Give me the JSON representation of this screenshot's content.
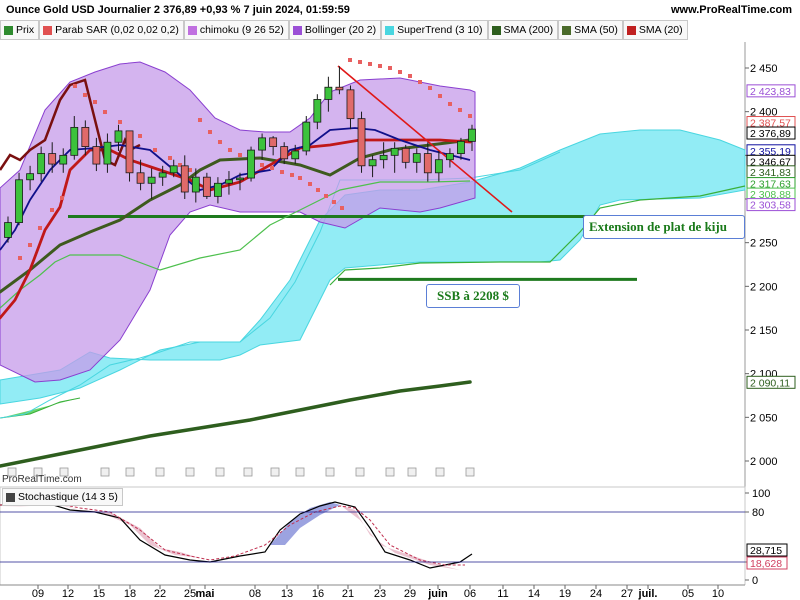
{
  "header": {
    "title": "Ounce Gold USD Journalier 2 376,89 +0,93 % 7 juin 2024, 01:59:59",
    "site": "www.ProRealTime.com"
  },
  "legend": [
    {
      "label": "Prix",
      "color": "#2e8b2e",
      "icon": "price-swatch"
    },
    {
      "label": "Parab SAR (0,02 0,02 0,2)",
      "color": "#e05050",
      "icon": "sar-swatch"
    },
    {
      "label": "chimoku (9 26 52)",
      "color": "#c070e0",
      "icon": "ichimoku-swatch"
    },
    {
      "label": "Bollinger (20 2)",
      "color": "#9b4fd6",
      "icon": "bollinger-swatch"
    },
    {
      "label": "SuperTrend (3 10)",
      "color": "#49d6e0",
      "icon": "supertrend-swatch"
    },
    {
      "label": "SMA (200)",
      "color": "#2e5e1e",
      "icon": "sma200-swatch"
    },
    {
      "label": "SMA (50)",
      "color": "#4a6a2a",
      "icon": "sma50-swatch"
    },
    {
      "label": "SMA (20)",
      "color": "#c02020",
      "icon": "sma20-swatch"
    }
  ],
  "annotations": {
    "extension": "Extension de plat de kiju",
    "ssb": "SSB à 2208 $"
  },
  "logo": "ProRealTime.com",
  "stochastic": {
    "label": "Stochastique (14 3 5)",
    "axis_ticks": [
      "100",
      "80",
      "20",
      "0"
    ],
    "badges": [
      {
        "value": "28,715",
        "color": "#000000"
      },
      {
        "value": "18,628",
        "color": "#d04060"
      }
    ]
  },
  "chart_data": {
    "type": "candlestick",
    "title": "Ounce Gold USD Journalier 2 376,89 +0,93 % 7 juin 2024, 01:59:59",
    "y_ticks": [
      "2 450",
      "2 400",
      "2 350",
      "2 300",
      "2 250",
      "2 200",
      "2 150",
      "2 100",
      "2 050",
      "2 000"
    ],
    "y_tick_values": [
      2450,
      2400,
      2350,
      2300,
      2250,
      2200,
      2150,
      2100,
      2050,
      2000
    ],
    "ylim": [
      1990,
      2475
    ],
    "x_ticks": [
      "09",
      "12",
      "15",
      "18",
      "22",
      "25",
      "mai",
      "08",
      "13",
      "16",
      "21",
      "23",
      "29",
      "juin",
      "06",
      "11",
      "14",
      "19",
      "24",
      "27",
      "juil.",
      "05",
      "10"
    ],
    "price_badges": [
      {
        "value": "2 423,83",
        "color": "#9b4fd6",
        "y": 2423.83
      },
      {
        "value": "2 387,57",
        "color": "#e05050",
        "y": 2387.57
      },
      {
        "value": "2 376,89",
        "color": "#000000",
        "y": 2376.89
      },
      {
        "value": "2 355,19",
        "color": "#1010a0",
        "y": 2355.19
      },
      {
        "value": "2 346,67",
        "color": "#000000",
        "y": 2346.67
      },
      {
        "value": "2 341,83",
        "color": "#2e5e1e",
        "y": 2341.83
      },
      {
        "value": "2 317,63",
        "color": "#2ea02e",
        "y": 2317.63
      },
      {
        "value": "2 308,88",
        "color": "#4ec04e",
        "y": 2308.88
      },
      {
        "value": "2 303,58",
        "color": "#9b4fd6",
        "y": 2303.58
      },
      {
        "value": "2 090,11",
        "color": "#2e5e1e",
        "y": 2090.11
      }
    ],
    "candles": [
      [
        2256,
        2280,
        2250,
        2273
      ],
      [
        2273,
        2330,
        2270,
        2322
      ],
      [
        2322,
        2338,
        2310,
        2329
      ],
      [
        2329,
        2360,
        2320,
        2352
      ],
      [
        2352,
        2365,
        2330,
        2340
      ],
      [
        2340,
        2358,
        2330,
        2350
      ],
      [
        2350,
        2395,
        2345,
        2382
      ],
      [
        2382,
        2390,
        2350,
        2360
      ],
      [
        2360,
        2370,
        2332,
        2340
      ],
      [
        2340,
        2375,
        2330,
        2365
      ],
      [
        2365,
        2385,
        2355,
        2378
      ],
      [
        2378,
        2370,
        2320,
        2330
      ],
      [
        2330,
        2345,
        2310,
        2318
      ],
      [
        2318,
        2335,
        2300,
        2325
      ],
      [
        2325,
        2338,
        2315,
        2330
      ],
      [
        2330,
        2345,
        2325,
        2338
      ],
      [
        2338,
        2350,
        2300,
        2308
      ],
      [
        2308,
        2335,
        2296,
        2325
      ],
      [
        2325,
        2330,
        2300,
        2303
      ],
      [
        2303,
        2325,
        2295,
        2318
      ],
      [
        2318,
        2332,
        2305,
        2322
      ],
      [
        2322,
        2330,
        2310,
        2324
      ],
      [
        2324,
        2360,
        2320,
        2356
      ],
      [
        2356,
        2375,
        2345,
        2370
      ],
      [
        2370,
        2372,
        2350,
        2360
      ],
      [
        2360,
        2365,
        2340,
        2346
      ],
      [
        2346,
        2362,
        2340,
        2355
      ],
      [
        2355,
        2395,
        2350,
        2388
      ],
      [
        2388,
        2420,
        2380,
        2414
      ],
      [
        2414,
        2440,
        2400,
        2428
      ],
      [
        2428,
        2452,
        2420,
        2425
      ],
      [
        2425,
        2430,
        2380,
        2392
      ],
      [
        2392,
        2400,
        2330,
        2338
      ],
      [
        2338,
        2350,
        2325,
        2345
      ],
      [
        2345,
        2365,
        2335,
        2350
      ],
      [
        2350,
        2365,
        2330,
        2358
      ],
      [
        2358,
        2362,
        2335,
        2342
      ],
      [
        2342,
        2358,
        2330,
        2352
      ],
      [
        2352,
        2365,
        2320,
        2330
      ],
      [
        2330,
        2355,
        2320,
        2345
      ],
      [
        2345,
        2358,
        2336,
        2352
      ],
      [
        2352,
        2370,
        2345,
        2366
      ],
      [
        2366,
        2385,
        2355,
        2380
      ]
    ],
    "x_index_range": [
      0,
      42
    ],
    "series": [
      {
        "name": "SMA (20)",
        "color": "#c02020"
      },
      {
        "name": "SMA (50)",
        "color": "#4a6a2a"
      },
      {
        "name": "SMA (200)",
        "color": "#2e5e1e"
      },
      {
        "name": "Bollinger (20 2)",
        "color": "#9b4fd6"
      },
      {
        "name": "SuperTrend (3 10)",
        "color": "#49d6e0"
      },
      {
        "name": "Parab SAR (0,02 0,02 0,2)",
        "color": "#e05050"
      }
    ],
    "horizontal_levels": [
      2280,
      2208
    ]
  }
}
